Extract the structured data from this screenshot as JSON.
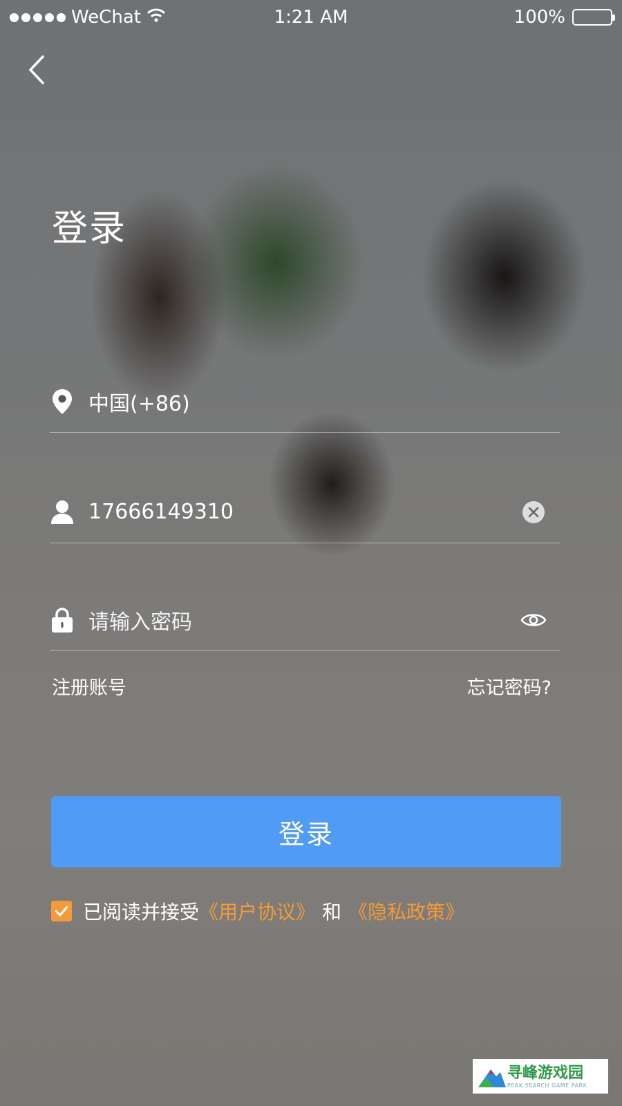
{
  "status_bar": {
    "carrier": "WeChat",
    "time": "1:21 AM",
    "battery": "100%"
  },
  "page": {
    "title": "登录"
  },
  "form": {
    "country": "中国(+86)",
    "phone": "17666149310",
    "password_placeholder": "请输入密码"
  },
  "links": {
    "register": "注册账号",
    "forgot": "忘记密码?"
  },
  "login_button": "登录",
  "agreement": {
    "prefix": "已阅读并接受",
    "user_agreement": "《用户协议》",
    "and": "和",
    "privacy_policy": "《隐私政策》",
    "checked": true
  },
  "watermark": {
    "name": "寻峰游戏园",
    "sub": "PEAK SEARCH GAME PARK"
  },
  "colors": {
    "accent_blue": "#4f9bf5",
    "accent_orange": "#f39b3a"
  },
  "icons": [
    "chevron-left-icon",
    "location-pin-icon",
    "user-icon",
    "clear-icon",
    "lock-icon",
    "eye-icon",
    "checkbox-icon",
    "wifi-icon",
    "battery-icon"
  ]
}
